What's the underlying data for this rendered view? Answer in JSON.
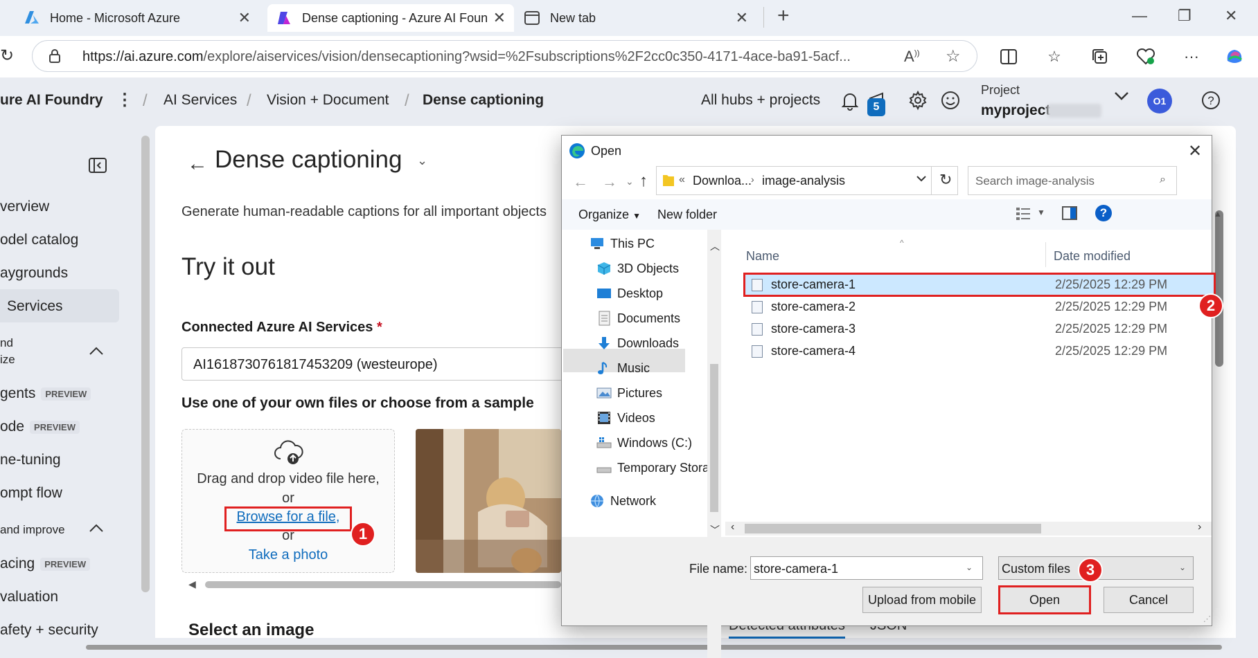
{
  "browser": {
    "tabs": [
      {
        "title": "Home - Microsoft Azure",
        "active": false
      },
      {
        "title": "Dense captioning - Azure AI Foun",
        "active": true
      },
      {
        "title": "New tab",
        "active": false
      }
    ],
    "url_host": "https://ai.azure.com",
    "url_path": "/explore/aiservices/vision/densecaptioning?wsid=%2Fsubscriptions%2F2cc0c350-4171-4ace-ba91-5acf..."
  },
  "header": {
    "app_name": "ure AI Foundry",
    "breadcrumb": [
      "AI Services",
      "Vision + Document",
      "Dense captioning"
    ],
    "all_hubs": "All hubs + projects",
    "notification_count": "5",
    "project_label": "Project",
    "project_name": "myproject",
    "avatar_initials": "O1"
  },
  "sidebar": {
    "items": [
      {
        "label": "verview",
        "badge": ""
      },
      {
        "label": "odel catalog",
        "badge": ""
      },
      {
        "label": "aygrounds",
        "badge": ""
      },
      {
        "label": "Services",
        "badge": "",
        "selected": true
      },
      {
        "label": "nd",
        "badge": ""
      },
      {
        "label": "ize",
        "badge": ""
      },
      {
        "label": "gents",
        "badge": "PREVIEW"
      },
      {
        "label": "ode",
        "badge": "PREVIEW"
      },
      {
        "label": "ne-tuning",
        "badge": ""
      },
      {
        "label": "ompt flow",
        "badge": ""
      },
      {
        "label": "and improve",
        "badge": ""
      },
      {
        "label": "acing",
        "badge": "PREVIEW"
      },
      {
        "label": "valuation",
        "badge": ""
      },
      {
        "label": "afety + security",
        "badge": ""
      }
    ]
  },
  "main": {
    "title": "Dense captioning",
    "description": "Generate human-readable captions for all important objects",
    "try_it_out": "Try it out",
    "connected_label": "Connected Azure AI Services",
    "required_mark": "*",
    "connected_value": "AI1618730761817453209 (westeurope)",
    "files_label": "Use one of your own files or choose from a sample",
    "drag_text": "Drag and drop video file here,",
    "or1": "or",
    "browse_link": "Browse for a file,",
    "or2": "or",
    "take_photo": "Take a photo",
    "select_image": "Select an image",
    "result_tabs": [
      "Detected attributes",
      "JSON"
    ]
  },
  "dialog": {
    "title": "Open",
    "path": [
      "Downloa...",
      "image-analysis"
    ],
    "path_prefix": "«",
    "search_placeholder": "Search image-analysis",
    "organize": "Organize",
    "new_folder": "New folder",
    "tree": [
      {
        "label": "This PC",
        "icon": "pc-icon",
        "indent": 0
      },
      {
        "label": "3D Objects",
        "icon": "cube-icon",
        "indent": 1
      },
      {
        "label": "Desktop",
        "icon": "desktop-icon",
        "indent": 1
      },
      {
        "label": "Documents",
        "icon": "documents-icon",
        "indent": 1
      },
      {
        "label": "Downloads",
        "icon": "downloads-icon",
        "indent": 1,
        "selected": true
      },
      {
        "label": "Music",
        "icon": "music-icon",
        "indent": 1
      },
      {
        "label": "Pictures",
        "icon": "pictures-icon",
        "indent": 1
      },
      {
        "label": "Videos",
        "icon": "videos-icon",
        "indent": 1
      },
      {
        "label": "Windows (C:)",
        "icon": "drive-icon",
        "indent": 1
      },
      {
        "label": "Temporary Stora",
        "icon": "drive-icon",
        "indent": 1
      },
      {
        "label": "Network",
        "icon": "network-icon",
        "indent": 0
      }
    ],
    "col_name": "Name",
    "col_date": "Date modified",
    "files": [
      {
        "name": "store-camera-1",
        "date": "2/25/2025 12:29 PM",
        "selected": true
      },
      {
        "name": "store-camera-2",
        "date": "2/25/2025 12:29 PM"
      },
      {
        "name": "store-camera-3",
        "date": "2/25/2025 12:29 PM"
      },
      {
        "name": "store-camera-4",
        "date": "2/25/2025 12:29 PM"
      }
    ],
    "file_name_label": "File name:",
    "file_name_value": "store-camera-1",
    "file_type": "Custom files",
    "upload_mobile": "Upload from mobile",
    "open_btn": "Open",
    "cancel_btn": "Cancel"
  },
  "callouts": [
    "1",
    "2",
    "3"
  ],
  "colors": {
    "accent": "#0f6cbd",
    "callout_red": "#e02020",
    "selection": "#cce8ff"
  }
}
